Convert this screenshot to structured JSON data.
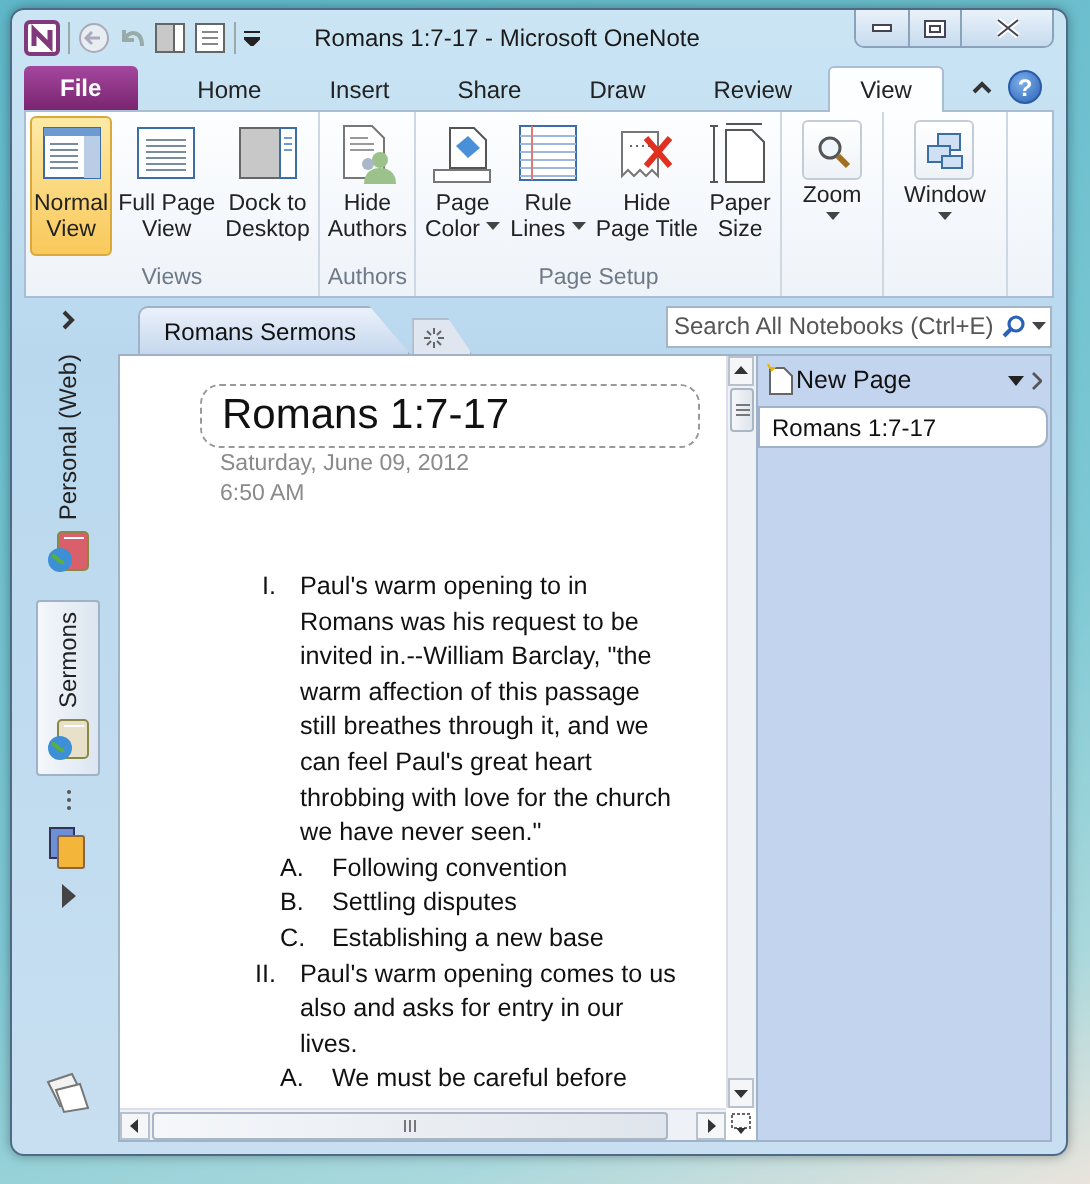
{
  "window": {
    "title": "Romans 1:7-17 - Microsoft OneNote"
  },
  "ribbon_tabs": [
    {
      "label": "File",
      "kind": "file",
      "selected": false
    },
    {
      "label": "Home",
      "kind": "tab",
      "selected": false
    },
    {
      "label": "Insert",
      "kind": "tab",
      "selected": false
    },
    {
      "label": "Share",
      "kind": "tab",
      "selected": false
    },
    {
      "label": "Draw",
      "kind": "tab",
      "selected": false
    },
    {
      "label": "Review",
      "kind": "tab",
      "selected": false
    },
    {
      "label": "View",
      "kind": "tab",
      "selected": true
    }
  ],
  "help_button": {
    "label": "?"
  },
  "ribbon_groups": [
    {
      "label": "Views",
      "buttons": [
        {
          "label": "Normal\nView",
          "selected": true,
          "dropdown": false
        },
        {
          "label": "Full Page\nView",
          "selected": false,
          "dropdown": false
        },
        {
          "label": "Dock to\nDesktop",
          "selected": false,
          "dropdown": false
        }
      ]
    },
    {
      "label": "Authors",
      "buttons": [
        {
          "label": "Hide\nAuthors",
          "selected": false,
          "dropdown": false
        }
      ]
    },
    {
      "label": "Page Setup",
      "buttons": [
        {
          "label": "Page\nColor",
          "selected": false,
          "dropdown": true
        },
        {
          "label": "Rule\nLines",
          "selected": false,
          "dropdown": true
        },
        {
          "label": "Hide\nPage Title",
          "selected": false,
          "dropdown": false
        },
        {
          "label": "Paper\nSize",
          "selected": false,
          "dropdown": false
        }
      ]
    }
  ],
  "big_buttons": [
    {
      "label": "Zoom",
      "dropdown": true
    },
    {
      "label": "Window",
      "dropdown": true
    }
  ],
  "notebooks": [
    {
      "label": "Personal (Web)",
      "selected": false
    },
    {
      "label": "Sermons",
      "selected": true
    }
  ],
  "section_tabs": [
    {
      "label": "Romans Sermons",
      "selected": true
    }
  ],
  "search": {
    "placeholder": "Search All Notebooks (Ctrl+E)"
  },
  "page": {
    "title": "Romans 1:7-17",
    "date": "Saturday, June 09, 2012",
    "time": "6:50 AM",
    "outline": [
      {
        "marker": "I.",
        "text": "Paul's warm opening to in Romans was his request to be invited in.--William Barclay, \"the warm affection of this passage still breathes through it, and we can feel Paul's great heart throbbing with love for the church we have never seen.\"",
        "children": [
          {
            "marker": "A.",
            "text": "Following convention"
          },
          {
            "marker": "B.",
            "text": "Settling disputes"
          },
          {
            "marker": "C.",
            "text": "Establishing a new base"
          }
        ]
      },
      {
        "marker": "II.",
        "text": "Paul's warm opening comes to us also and asks for entry in our lives.",
        "children": [
          {
            "marker": "A.",
            "text": "We must be careful before"
          }
        ]
      }
    ]
  },
  "page_list": {
    "new_page": "New Page",
    "pages": [
      {
        "label": "Romans 1:7-17",
        "selected": true
      }
    ]
  }
}
